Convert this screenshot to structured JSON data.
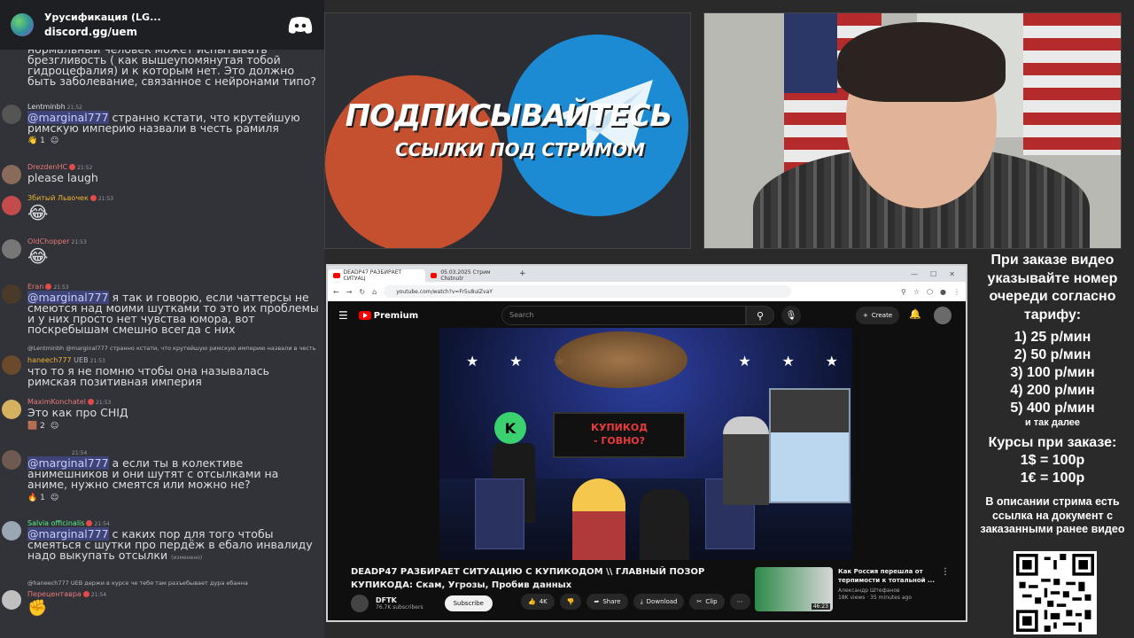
{
  "chat": {
    "server_title": "Урусификация (LG...",
    "server_link": "discord.gg/uem",
    "messages": [
      {
        "text_top": "нормальный человек может испытывать брезгливость ( как вышеупомянутая тобой гидроцефалия) и к которым нет.  Это должно быть заболевание, связанное с нейронами типо?"
      },
      {
        "user": "Lentminbh",
        "time": "21:52",
        "mention": "@marginal777",
        "text": " странно кстати, что крутейшую римскую империю назвали в честь рамиля",
        "react1": "1",
        "react2": ""
      },
      {
        "user": "DrezdenHC",
        "time": "21:52",
        "text": "please laugh"
      },
      {
        "user": "Збитый Львочек",
        "time": "21:53",
        "emoji": "😂"
      },
      {
        "user": "OldChopper",
        "time": "21:53",
        "emoji": "😂"
      },
      {
        "user": "Eran",
        "time": "21:53",
        "mention": "@marginal777",
        "text": " я так и говорю, если чаттерсы не смеются над моими шутками то это их проблемы и у них просто нет чувства юмора, вот поскребышам смешно всегда с них"
      },
      {
        "reply": "@Lentminbh @marginal777 странно кстати, что крутейшую римскую империю назвали в честь",
        "user": "haneech777",
        "tag": "UEB",
        "time": "21:53",
        "text": "что то я не помню чтобы она называлась римская позитивная империя"
      },
      {
        "user": "MaximKonchatel",
        "time": "21:53",
        "text": "Это как про СНІД",
        "react1": "2"
      },
      {
        "user": "",
        "time": "21:54",
        "mention": "@marginal777",
        "text": " а если ты в колективе анимешников и они шутят с отсылками на аниме, нужно смеятся или можно не?",
        "react1": "1"
      },
      {
        "user": "Salvia officinalis",
        "time": "21:54",
        "mention": "@marginal777",
        "text": " с каких пор для того чтобы смеяться с шутки про пердёж в ебало инвалиду надо выкупать отсылки",
        "edited": "(изменено)"
      },
      {
        "reply": "@haneech777 UEB держи в курсе че тебя там разъебывает дура ебанна",
        "user": "Перецентавра",
        "time": "21:54"
      }
    ]
  },
  "promo": {
    "title": "ПОДПИСЫВАЙТЕСЬ",
    "subtitle": "ССЫЛКИ ПОД СТРИМОМ"
  },
  "browser": {
    "tab1": "DEADP47 РАЗБИРАЕТ СИТУАЦ",
    "tab2": "05.03.2025 Стрим Chstnutr",
    "url": "youtube.com/watch?v=Fr5u8uIZvaY",
    "search_placeholder": "Search",
    "create_label": "Create",
    "premium_label": "Premium",
    "board_line1": "КУПИКОД",
    "board_line2": "- ГОВНО?",
    "k_letter": "K",
    "video_title": "DEADP47 РАЗБИРАЕТ СИТУАЦИЮ С КУПИКОДОМ \\\\ ГЛАВНЫЙ ПОЗОР КУПИКОДА: Скам, Угрозы, Пробив данных",
    "channel_name": "DFTK",
    "channel_subs": "76.7K subscribers",
    "subscribe_label": "Subscribe",
    "likes": "4K",
    "share_label": "Share",
    "download_label": "Download",
    "clip_label": "Clip",
    "rec_title": "Как Россия перешла от терпимости к тотальной ...",
    "rec_channel": "Александр Штефанов",
    "rec_meta": "18K views · 35 minutes ago",
    "rec_duration": "46:23"
  },
  "info": {
    "heading": "При заказе видео указывайте номер очереди согласно тарифу:",
    "prices": [
      "1) 25 р/мин",
      "2) 50 р/мин",
      "3) 100 р/мин",
      "4) 200 р/мин",
      "5) 400 р/мин"
    ],
    "etc": "и так далее",
    "courses_title": "Курсы при заказе:",
    "rate_usd": "1$ = 100р",
    "rate_eur": "1€ = 100р",
    "description": "В описании стрима есть ссылка на документ с заказанными ранее видео"
  }
}
